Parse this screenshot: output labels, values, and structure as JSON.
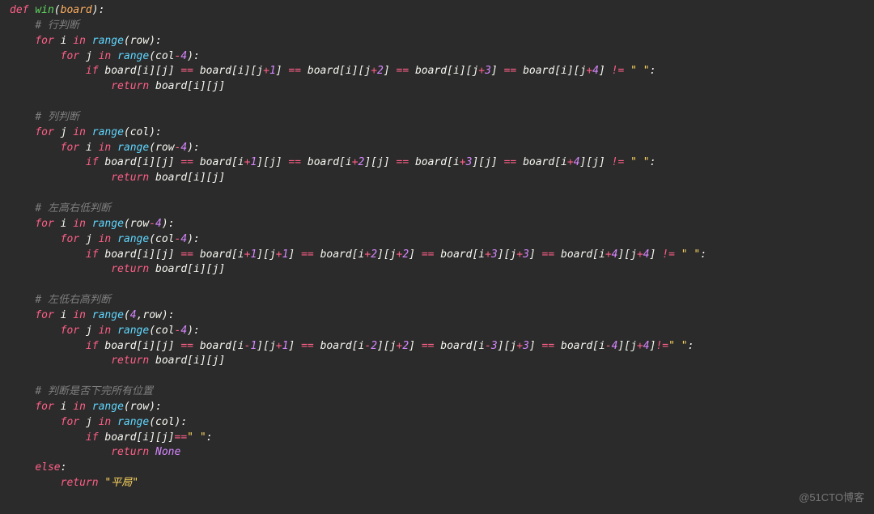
{
  "code": {
    "def": "def",
    "fn": "win",
    "param": "board",
    "c1": "# 行判断",
    "c2": "# 列判断",
    "c3": "# 左高右低判断",
    "c4": "# 左低右高判断",
    "c5": "# 判断是否下完所有位置",
    "for": "for",
    "in": "in",
    "if": "if",
    "return": "return",
    "else": "else",
    "range": "range",
    "i": "i",
    "j": "j",
    "row": "row",
    "col": "col",
    "board": "board",
    "none": "None",
    "tie": "\"平局\"",
    "space": "\" \"",
    "n1": "1",
    "n2": "2",
    "n3": "3",
    "n4": "4",
    "eq": "==",
    "ne": "!=",
    "minus": "-",
    "plus": "+",
    "comma": ","
  },
  "watermark": "@51CTO博客"
}
